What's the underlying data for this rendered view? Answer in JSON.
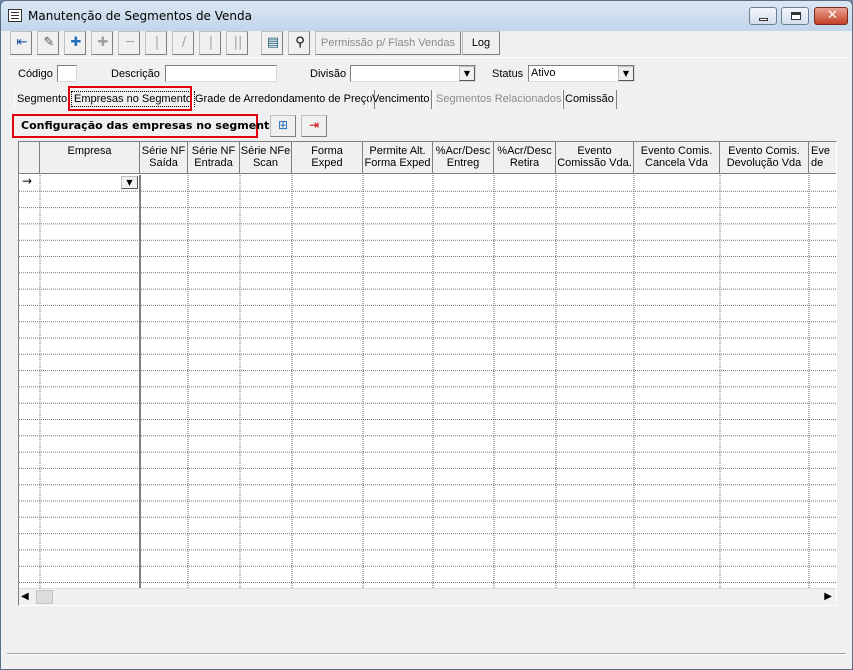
{
  "window": {
    "title": "Manutenção de Segmentos de Venda"
  },
  "toolbar": {
    "icons": [
      "exit-icon",
      "edit-icon",
      "add-icon",
      "new-disabled-icon",
      "remove-disabled-icon",
      "first-icon",
      "prev-icon",
      "next-icon",
      "last-icon",
      "list-icon",
      "binoculars-icon"
    ],
    "permission_label": "Permissão p/ Flash Vendas",
    "log_label": "Log"
  },
  "form": {
    "codigo_label": "Código",
    "codigo_value": "",
    "descricao_label": "Descrição",
    "descricao_value": "",
    "divisao_label": "Divisão",
    "divisao_value": "",
    "status_label": "Status",
    "status_value": "Ativo"
  },
  "tabs": [
    {
      "label": "Segmento"
    },
    {
      "label": "Empresas no Segmento"
    },
    {
      "label": "Grade de Arredondamento de Preço"
    },
    {
      "label": "Vencimento"
    },
    {
      "label": "Segmentos Relacionados"
    },
    {
      "label": "Comissão"
    }
  ],
  "section": {
    "title": "Configuração das empresas no segmento"
  },
  "grid": {
    "columns": [
      {
        "label": "Empresa"
      },
      {
        "label": "Série NF\nSaída"
      },
      {
        "label": "Série NF\nEntrada"
      },
      {
        "label": "Série NFe\nScan"
      },
      {
        "label": "Forma\nExped"
      },
      {
        "label": "Permite Alt.\nForma Exped"
      },
      {
        "label": "%Acr/Desc\nEntreg"
      },
      {
        "label": "%Acr/Desc\nRetira"
      },
      {
        "label": "Evento\nComissão Vda."
      },
      {
        "label": "Evento Comis.\nCancela Vda"
      },
      {
        "label": "Evento Comis.\nDevolução Vda"
      },
      {
        "label": "Eve\nde"
      }
    ],
    "current_row_marker": "→"
  },
  "colors": {
    "highlight": "#e0000f",
    "titlebar": "#c3d5ea"
  }
}
